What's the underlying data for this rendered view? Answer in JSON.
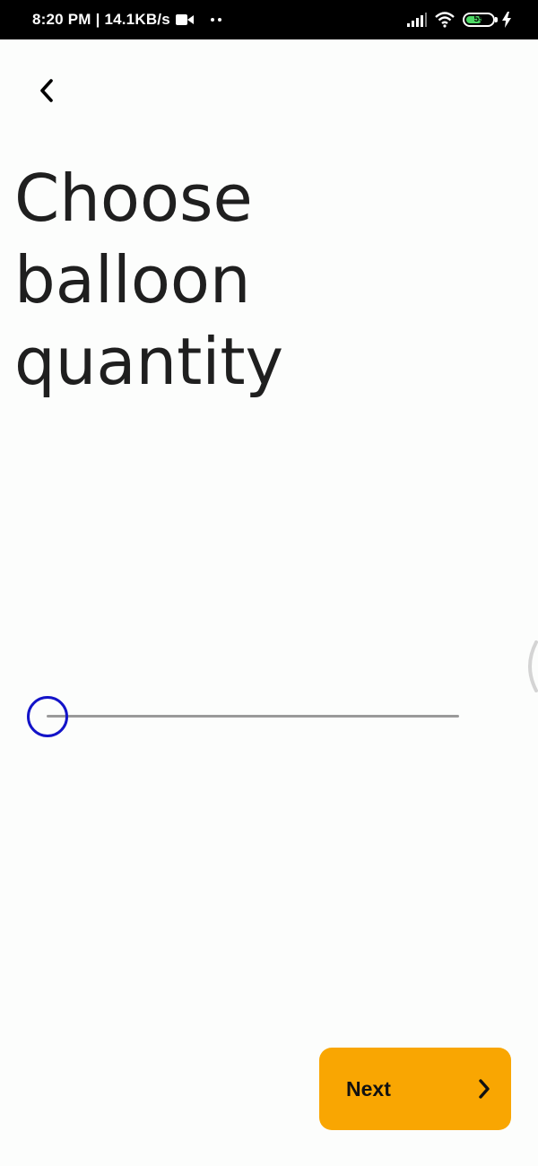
{
  "status_bar": {
    "time_speed": "8:20 PM | 14.1KB/s",
    "battery_level": "59",
    "battery_percent": 59,
    "battery_color": "#4cd964",
    "icons": [
      "video-camera-icon",
      "more-dots-icon",
      "signal-icon",
      "wifi-icon",
      "battery-icon",
      "charging-bolt-icon"
    ]
  },
  "header": {
    "back_icon": "chevron-left-icon"
  },
  "main": {
    "title": "Choose\nballoon\nquantity",
    "slider": {
      "value_fraction": 0.0,
      "thumb_color": "#1313c8",
      "track_color": "#9a9a9a"
    }
  },
  "footer": {
    "next_label": "Next",
    "next_icon": "chevron-right-icon",
    "next_color": "#f9a602"
  }
}
